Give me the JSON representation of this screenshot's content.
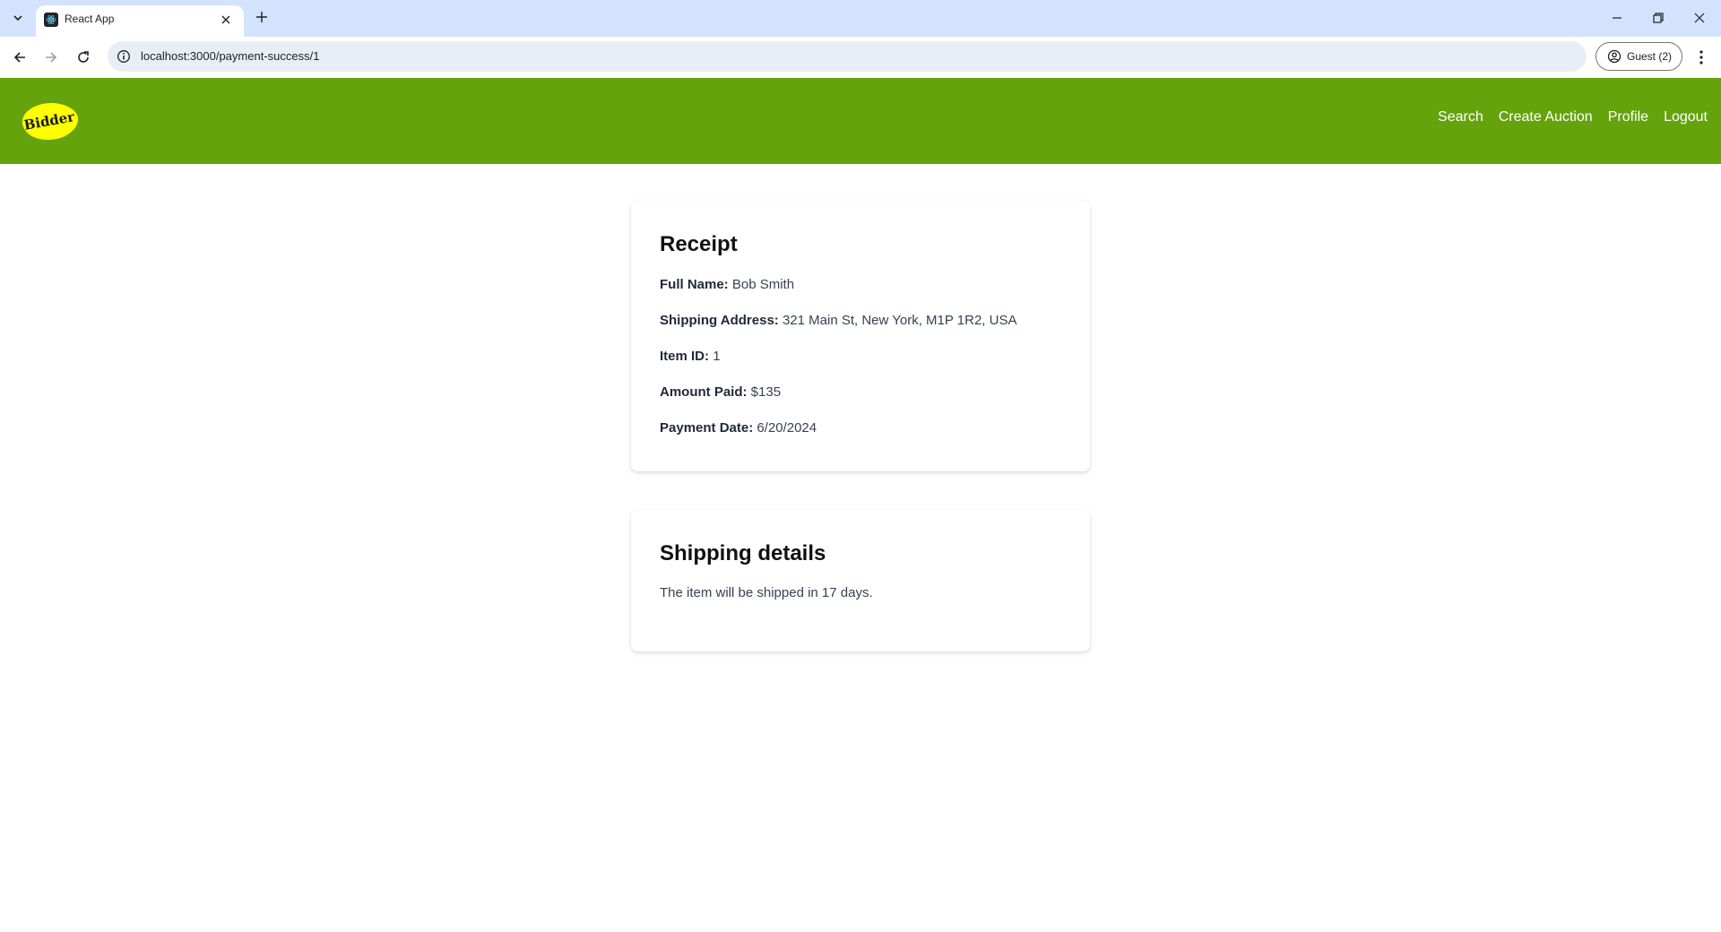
{
  "browser": {
    "tab_title": "React App",
    "url": "localhost:3000/payment-success/1",
    "profile_label": "Guest (2)"
  },
  "header": {
    "logo_text": "Bidder",
    "logo_color": "#ffff00",
    "brand_color": "#65a30d",
    "nav": [
      "Search",
      "Create Auction",
      "Profile",
      "Logout"
    ]
  },
  "receipt": {
    "title": "Receipt",
    "fields": [
      {
        "label": "Full Name:",
        "value": "Bob Smith"
      },
      {
        "label": "Shipping Address:",
        "value": "321 Main St, New York, M1P 1R2, USA"
      },
      {
        "label": "Item ID:",
        "value": "1"
      },
      {
        "label": "Amount Paid:",
        "value": "$135"
      },
      {
        "label": "Payment Date:",
        "value": "6/20/2024"
      }
    ]
  },
  "shipping": {
    "title": "Shipping details",
    "text": "The item will be shipped in 17 days."
  }
}
